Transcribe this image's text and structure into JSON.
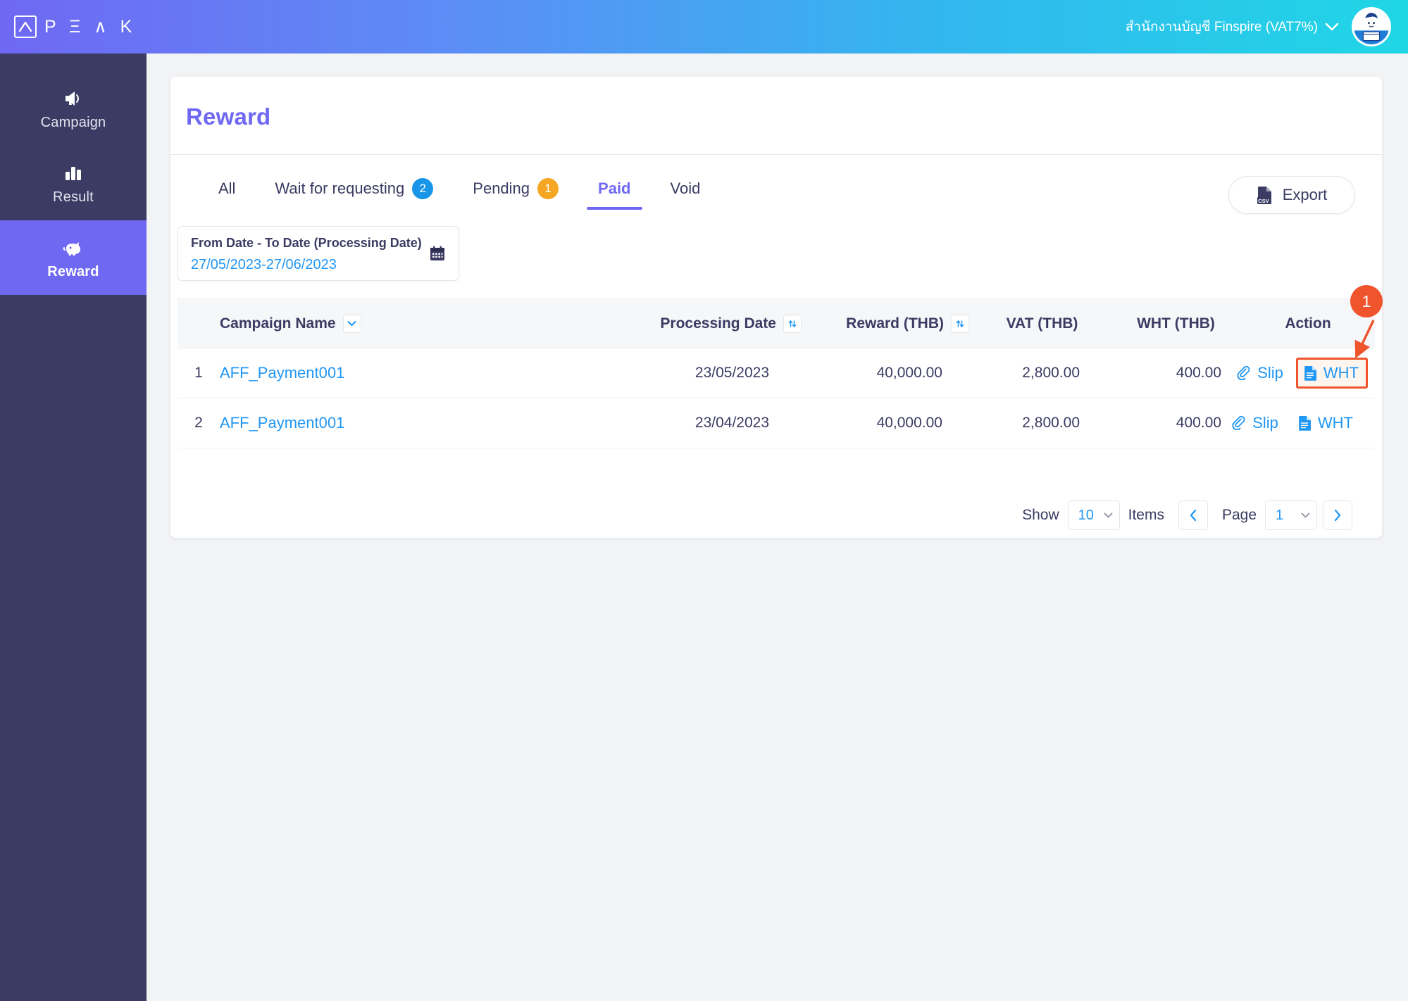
{
  "header": {
    "brand": "P Ξ ∧ K",
    "brand_plain": "PEAK",
    "account_name": "สำนักงานบัญชี Finspire (VAT7%)",
    "gradient_start": "#6f68f3",
    "gradient_end": "#20d6e5"
  },
  "sidebar": {
    "background": "#3b3b63",
    "active_color": "#6f68f3",
    "items": [
      {
        "label": "Campaign",
        "icon": "megaphone-icon",
        "active": false
      },
      {
        "label": "Result",
        "icon": "bar-chart-icon",
        "active": false
      },
      {
        "label": "Reward",
        "icon": "piggy-bank-icon",
        "active": true
      }
    ]
  },
  "card": {
    "title": "Reward",
    "title_color": "#6f68f3"
  },
  "tabs": [
    {
      "label": "All",
      "badge": null,
      "badge_color": null,
      "active": false
    },
    {
      "label": "Wait for requesting",
      "badge": "2",
      "badge_color": "#1a96e8",
      "active": false
    },
    {
      "label": "Pending",
      "badge": "1",
      "badge_color": "#f5a623",
      "active": false
    },
    {
      "label": "Paid",
      "badge": null,
      "badge_color": null,
      "active": true
    },
    {
      "label": "Void",
      "badge": null,
      "badge_color": null,
      "active": false
    }
  ],
  "export": {
    "label": "Export",
    "icon": "csv-file-icon"
  },
  "date_filter": {
    "label": "From Date - To Date (Processing Date)",
    "value": "27/05/2023-27/06/2023",
    "icon": "calendar-icon"
  },
  "table": {
    "columns": [
      {
        "key": "index",
        "label": ""
      },
      {
        "key": "campaign_name",
        "label": "Campaign Name",
        "control": "chevron-down-icon"
      },
      {
        "key": "processing_date",
        "label": "Processing Date",
        "control": "sort-icon"
      },
      {
        "key": "reward",
        "label": "Reward (THB)",
        "control": "sort-icon"
      },
      {
        "key": "vat",
        "label": "VAT (THB)",
        "control": null
      },
      {
        "key": "wht",
        "label": "WHT (THB)",
        "control": null
      },
      {
        "key": "action",
        "label": "Action",
        "control": null
      }
    ],
    "rows": [
      {
        "index": "1",
        "campaign_name": "AFF_Payment001",
        "processing_date": "23/05/2023",
        "reward": "40,000.00",
        "vat": "2,800.00",
        "wht": "400.00",
        "actions": [
          {
            "label": "Slip",
            "icon": "paperclip-icon",
            "highlighted": false
          },
          {
            "label": "WHT",
            "icon": "document-icon",
            "highlighted": true
          }
        ]
      },
      {
        "index": "2",
        "campaign_name": "AFF_Payment001",
        "processing_date": "23/04/2023",
        "reward": "40,000.00",
        "vat": "2,800.00",
        "wht": "400.00",
        "actions": [
          {
            "label": "Slip",
            "icon": "paperclip-icon",
            "highlighted": false
          },
          {
            "label": "WHT",
            "icon": "document-icon",
            "highlighted": false
          }
        ]
      }
    ]
  },
  "annotation": {
    "number": "1",
    "color": "#f0542d",
    "points_to": "WHT action link of row 1"
  },
  "pagination": {
    "show_label": "Show",
    "show_value": "10",
    "items_label": "Items",
    "page_label": "Page",
    "page_value": "1",
    "prev_icon": "chevron-left-icon",
    "next_icon": "chevron-right-icon"
  }
}
